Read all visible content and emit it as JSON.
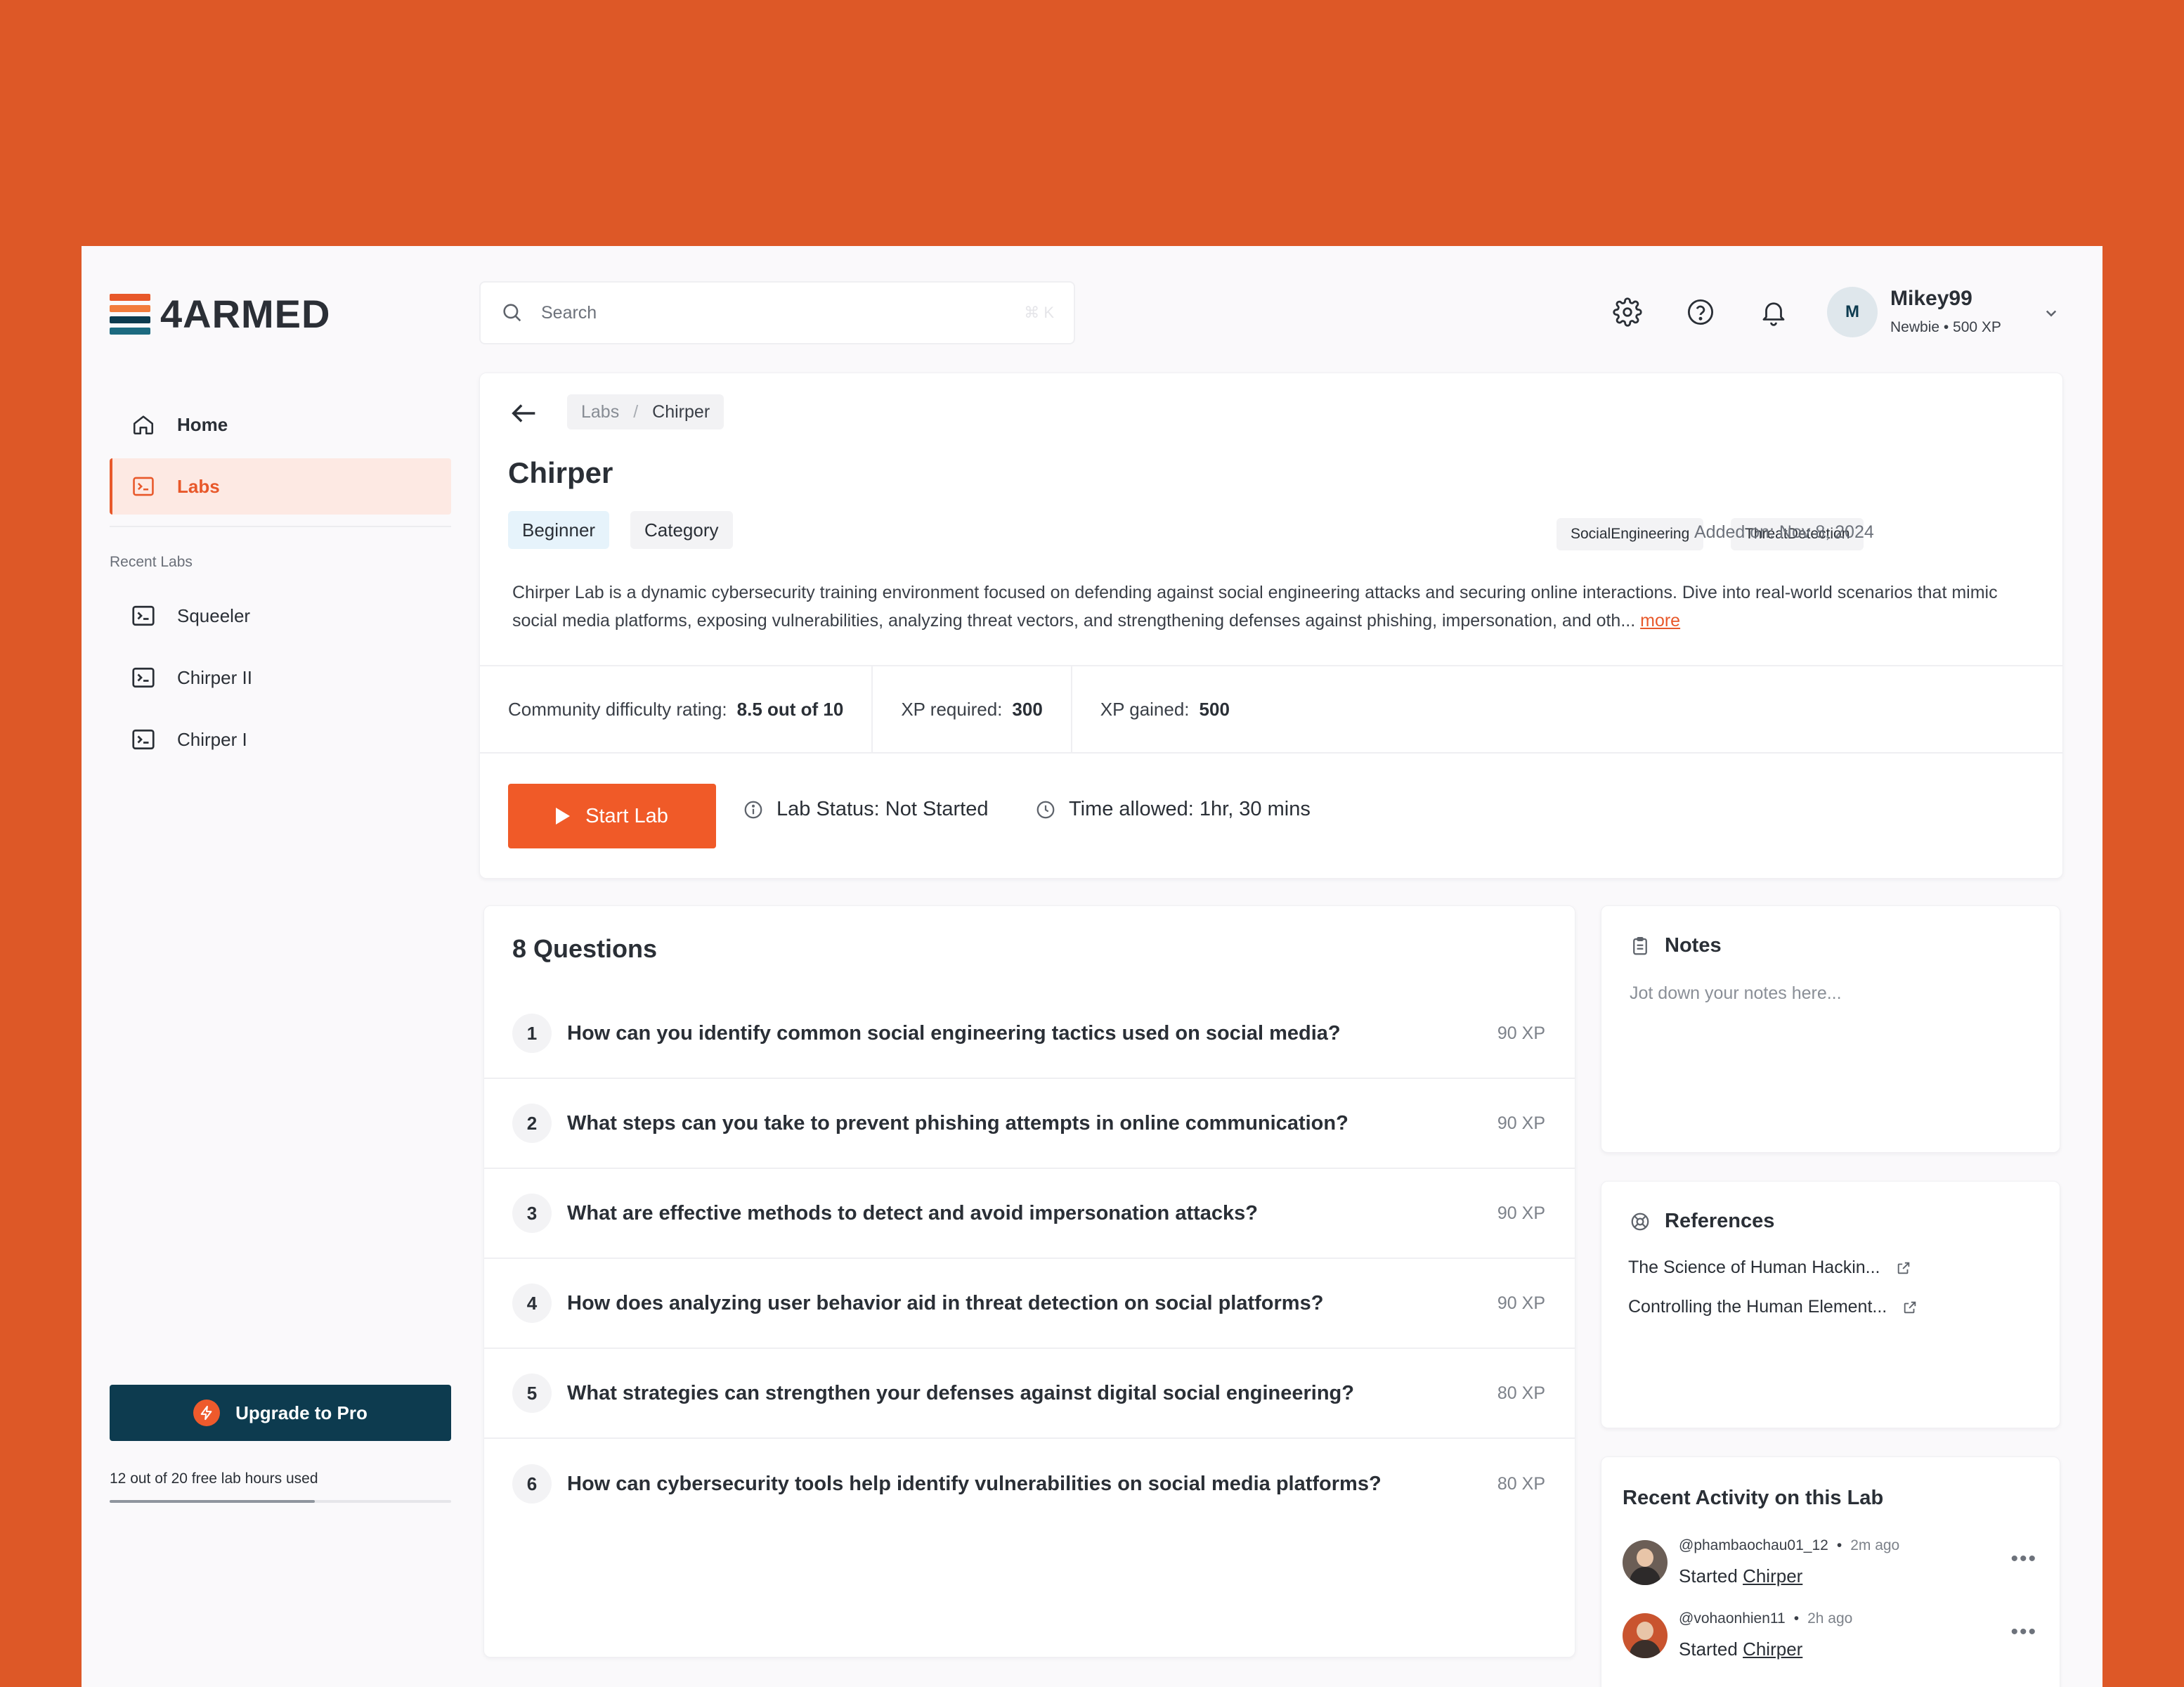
{
  "brand": {
    "name": "4ARMED",
    "colors": [
      "#e8582a",
      "#f27c3c",
      "#0d3b4f"
    ]
  },
  "nav": {
    "items": [
      {
        "label": "Home",
        "icon": "home-icon",
        "active": false
      },
      {
        "label": "Labs",
        "icon": "terminal-icon",
        "active": true
      }
    ],
    "recent_title": "Recent Labs",
    "recent": [
      {
        "label": "Squeeler",
        "icon": "terminal-icon"
      },
      {
        "label": "Chirper II",
        "icon": "terminal-icon"
      },
      {
        "label": "Chirper I",
        "icon": "terminal-icon"
      }
    ],
    "upgrade_label": "Upgrade to Pro",
    "usage_text": "12 out of 20 free lab hours used",
    "usage_fraction": 0.6
  },
  "header": {
    "search_placeholder": "Search",
    "search_shortcut": "⌘ K",
    "icons": [
      "gear-icon",
      "help-icon",
      "bell-icon"
    ],
    "user": {
      "initial": "M",
      "name": "Mikey99",
      "meta": "Newbie • 500 XP"
    }
  },
  "lab": {
    "breadcrumb": [
      "Labs",
      "Chirper"
    ],
    "title": "Chirper",
    "level": "Beginner",
    "category": "Category",
    "tags": [
      "SocialEngineering",
      "ThreatDetection"
    ],
    "added": "Added on: Nov 8, 2024",
    "description": "Chirper Lab is a dynamic cybersecurity training environment focused on defending against social engineering attacks and securing online interactions. Dive into real-world scenarios that mimic social media platforms, exposing vulnerabilities, analyzing threat vectors, and strengthening defenses against phishing, impersonation, and oth...",
    "more_label": "more",
    "stats": [
      {
        "label": "Community difficulty rating:",
        "value": "8.5 out of 10"
      },
      {
        "label": "XP required:",
        "value": "300"
      },
      {
        "label": "XP gained:",
        "value": "500"
      }
    ],
    "start_label": "Start Lab",
    "status_text": "Lab Status: Not Started",
    "time_text": "Time allowed: 1hr, 30 mins"
  },
  "questions": {
    "title": "8 Questions",
    "items": [
      {
        "num": "1",
        "text": "How can you identify common social engineering tactics used on social media?",
        "xp": "90 XP"
      },
      {
        "num": "2",
        "text": "What steps can you take to prevent phishing attempts in online communication?",
        "xp": "90 XP"
      },
      {
        "num": "3",
        "text": "What are effective methods to detect and avoid impersonation attacks?",
        "xp": "90 XP"
      },
      {
        "num": "4",
        "text": "How does analyzing user behavior aid in threat detection on social platforms?",
        "xp": "90 XP"
      },
      {
        "num": "5",
        "text": "What strategies can strengthen your defenses against digital social engineering?",
        "xp": "80 XP"
      },
      {
        "num": "6",
        "text": "How can cybersecurity tools help identify vulnerabilities on social media platforms?",
        "xp": "80 XP"
      }
    ]
  },
  "notes": {
    "title": "Notes",
    "placeholder": "Jot down your notes here..."
  },
  "references": {
    "title": "References",
    "items": [
      "The Science of Human Hackin...",
      "Controlling the Human Element..."
    ]
  },
  "activity": {
    "title": "Recent Activity on this Lab",
    "items": [
      {
        "user": "@phambaochau01_12",
        "ago": "2m ago",
        "action": "Started",
        "target": "Chirper"
      },
      {
        "user": "@vohaonhien11",
        "ago": "2h ago",
        "action": "Started",
        "target": "Chirper"
      }
    ]
  }
}
